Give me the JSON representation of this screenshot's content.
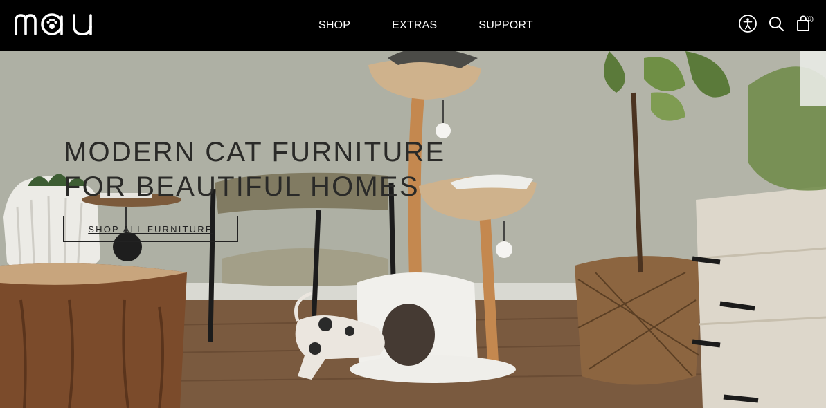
{
  "header": {
    "logo_text": "mau",
    "nav": [
      {
        "label": "SHOP"
      },
      {
        "label": "EXTRAS"
      },
      {
        "label": "SUPPORT"
      }
    ],
    "icons": {
      "accessibility": "accessibility-icon",
      "search": "search-icon",
      "cart": "shopping-bag-icon"
    },
    "cart_count": "(0)"
  },
  "hero": {
    "title_line1": "MODERN CAT FURNITURE",
    "title_line2": "FOR BEAUTIFUL HOMES",
    "cta_label": "SHOP ALL FURNITURE"
  },
  "colors": {
    "header_bg": "#000000",
    "header_text": "#ffffff",
    "hero_text": "#2a2a28"
  }
}
